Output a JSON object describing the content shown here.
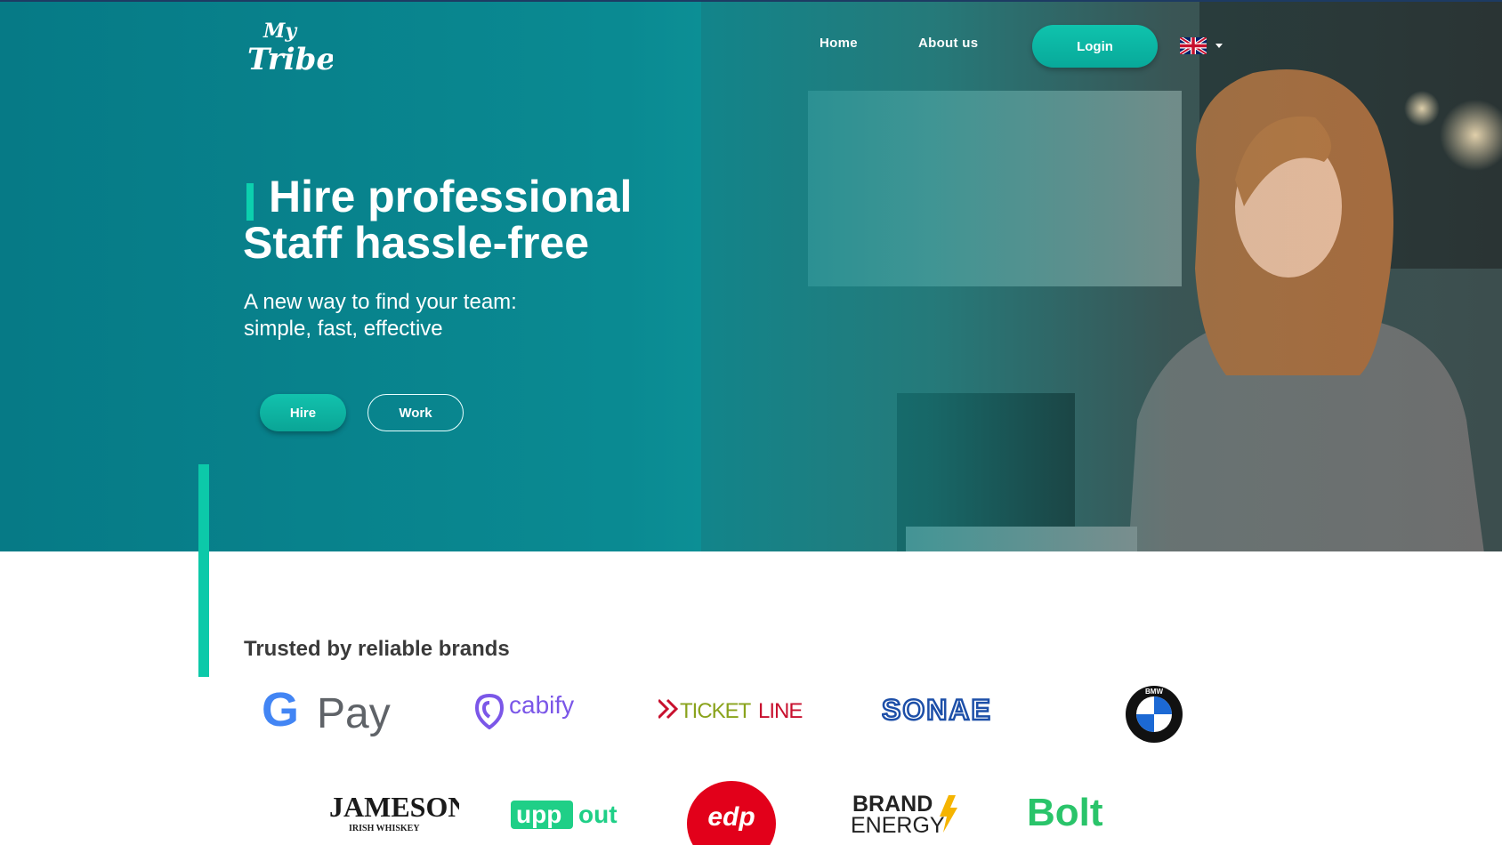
{
  "nav": {
    "logo_text_1": "My",
    "logo_text_2": "Tribe",
    "home": "Home",
    "about": "About us",
    "login": "Login",
    "language_icon": "uk-flag-icon"
  },
  "hero": {
    "title_line1": "Hire professional",
    "title_line2": "Staff hassle-free",
    "subtitle_line1": "A new way to find your team:",
    "subtitle_line2": "simple, fast, effective",
    "hire_label": "Hire",
    "work_label": "Work"
  },
  "brands": {
    "heading": "Trusted by reliable brands",
    "items": [
      {
        "name": "G Pay",
        "gpay_g": "G",
        "gpay_pay": "Pay"
      },
      {
        "name": "cabify"
      },
      {
        "name": "TICKETLINE",
        "part_a": "TICKET",
        "part_b": "LINE"
      },
      {
        "name": "SONAE"
      },
      {
        "name": "BMW"
      },
      {
        "name": "JAMESON",
        "sub": "IRISH WHISKEY"
      },
      {
        "name": "uppout",
        "part_a": "upp",
        "part_b": "out"
      },
      {
        "name": "edp"
      },
      {
        "name": "BRAND ENERGY",
        "part_a": "BRAND",
        "part_b": "ENERGY"
      },
      {
        "name": "Bolt"
      }
    ]
  },
  "colors": {
    "primary": "#0cc9a9",
    "hero_teal": "#0b7f8a"
  }
}
